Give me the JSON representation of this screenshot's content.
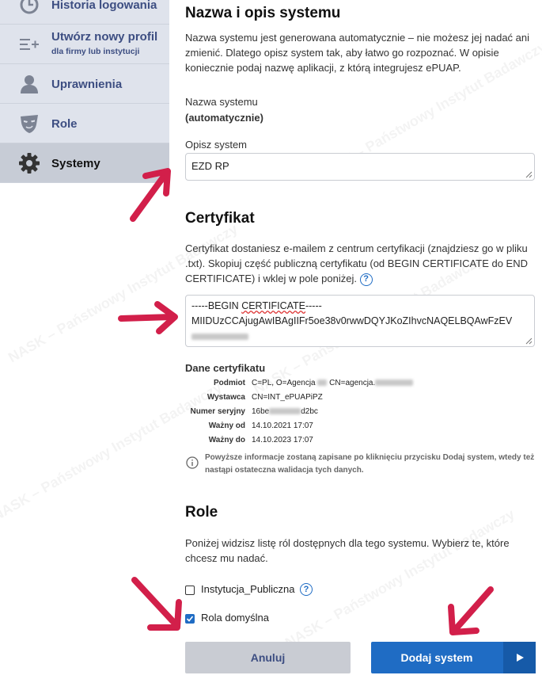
{
  "sidebar": {
    "items": [
      {
        "label": "Historia logowania",
        "icon": "clock-icon"
      },
      {
        "label": "Utwórz nowy profil",
        "sub": "dla firmy lub instytucji",
        "icon": "add-list-icon"
      },
      {
        "label": "Uprawnienia",
        "icon": "user-icon"
      },
      {
        "label": "Role",
        "icon": "mask-icon"
      },
      {
        "label": "Systemy",
        "icon": "gear-icon"
      }
    ]
  },
  "system": {
    "heading": "Nazwa i opis systemu",
    "description": "Nazwa systemu jest generowana automatycznie – nie możesz jej nadać ani zmienić. Dlatego opisz system tak, aby łatwo go rozpoznać. W opisie koniecznie podaj nazwę aplikacji, z którą integrujesz ePUAP.",
    "name_label": "Nazwa systemu",
    "name_value": "(automatycznie)",
    "describe_label": "Opisz system",
    "describe_value": "EZD RP"
  },
  "certificate": {
    "heading": "Certyfikat",
    "description": "Certyfikat dostaniesz e-mailem z centrum certyfikacji (znajdziesz go w pliku .txt). Skopiuj część publiczną certyfikatu (od BEGIN CERTIFICATE do END CERTIFICATE) i wklej w pole poniżej.",
    "line1_prefix": "-----BEGIN ",
    "line1_word": "CERTIFICATE",
    "line1_suffix": "-----",
    "line2": "MIIDUzCCAjugAwIBAgIIFr5oe38v0rwwDQYJKoZIhvcNAQELBQAwFzEV",
    "data_heading": "Dane certyfikatu",
    "rows": [
      {
        "key": "Podmiot",
        "value_a": "C=PL, O=Agencja ",
        "value_b": " CN=agencja."
      },
      {
        "key": "Wystawca",
        "value_a": "CN=INT_ePUAPiPZ",
        "value_b": ""
      },
      {
        "key": "Numer seryjny",
        "value_a": "16be",
        "value_b": "d2bc"
      },
      {
        "key": "Ważny od",
        "value_a": "14.10.2021 17:07",
        "value_b": ""
      },
      {
        "key": "Ważny do",
        "value_a": "14.10.2023 17:07",
        "value_b": ""
      }
    ],
    "info": "Powyższe informacje zostaną zapisane po kliknięciu przycisku Dodaj system, wtedy też nastąpi ostateczna walidacja tych danych."
  },
  "roles": {
    "heading": "Role",
    "description": "Poniżej widzisz listę ról dostępnych dla tego systemu. Wybierz te, które chcesz mu nadać.",
    "options": [
      {
        "label": "Instytucja_Publiczna",
        "checked": false
      },
      {
        "label": "Rola domyślna",
        "checked": true
      }
    ]
  },
  "buttons": {
    "cancel": "Anuluj",
    "add": "Dodaj system"
  },
  "watermark_text": "NASK – Państwowy Instytut Badawczy",
  "colors": {
    "sidebar_bg": "#dfe3ec",
    "sidebar_text": "#3d4e82",
    "primary": "#1f6cc4",
    "arrow": "#d21f4a"
  }
}
